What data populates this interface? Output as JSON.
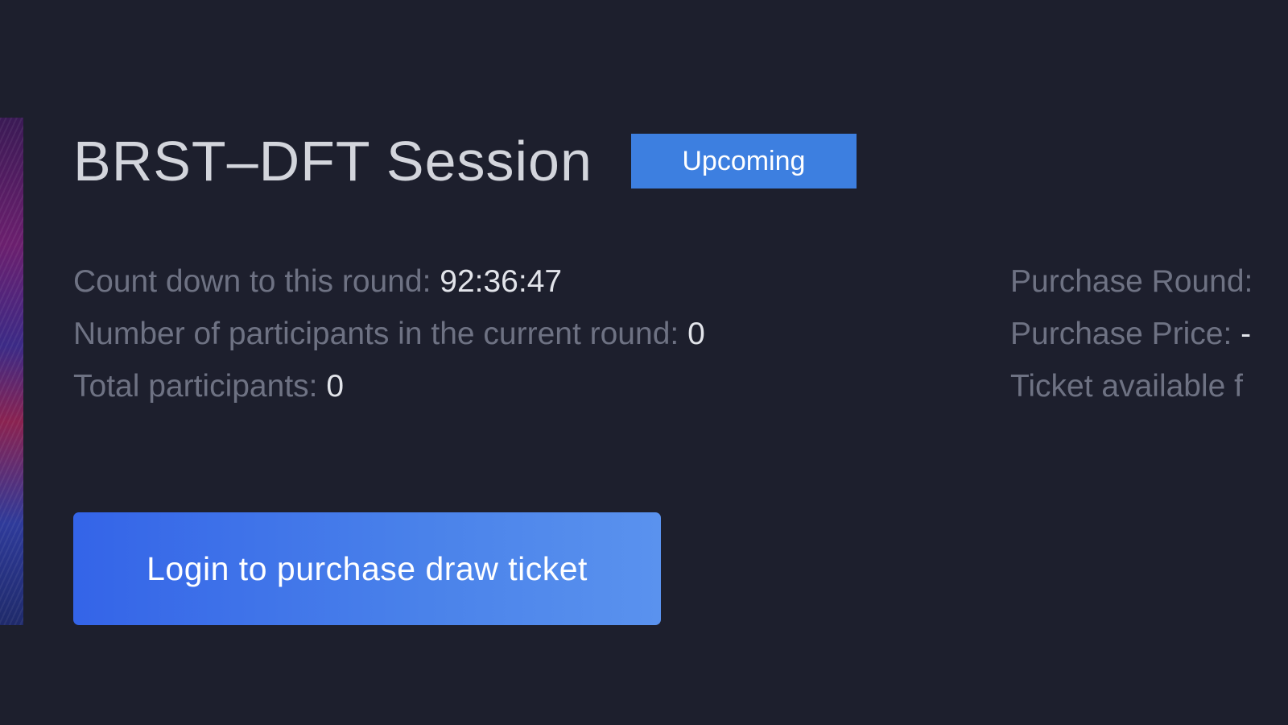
{
  "session": {
    "title": "BRST–DFT Session",
    "status_badge": "Upcoming"
  },
  "stats_left": [
    {
      "label": "Count down to this round: ",
      "value": "92:36:47"
    },
    {
      "label": "Number of participants in the current round: ",
      "value": "0"
    },
    {
      "label": "Total participants: ",
      "value": "0"
    }
  ],
  "stats_right": [
    {
      "label": "Purchase Round:",
      "value": ""
    },
    {
      "label": "Purchase Price: ",
      "value": "-"
    },
    {
      "label": "Ticket available f",
      "value": ""
    }
  ],
  "actions": {
    "login_button_label": "Login to purchase draw ticket"
  },
  "colors": {
    "background": "#1d1f2d",
    "badge": "#3d7fe0",
    "button_start": "#3464e8",
    "button_end": "#5a92ee",
    "label_text": "#6e7283",
    "value_text": "#e2e4ea",
    "title_text": "#d3d5dc"
  }
}
